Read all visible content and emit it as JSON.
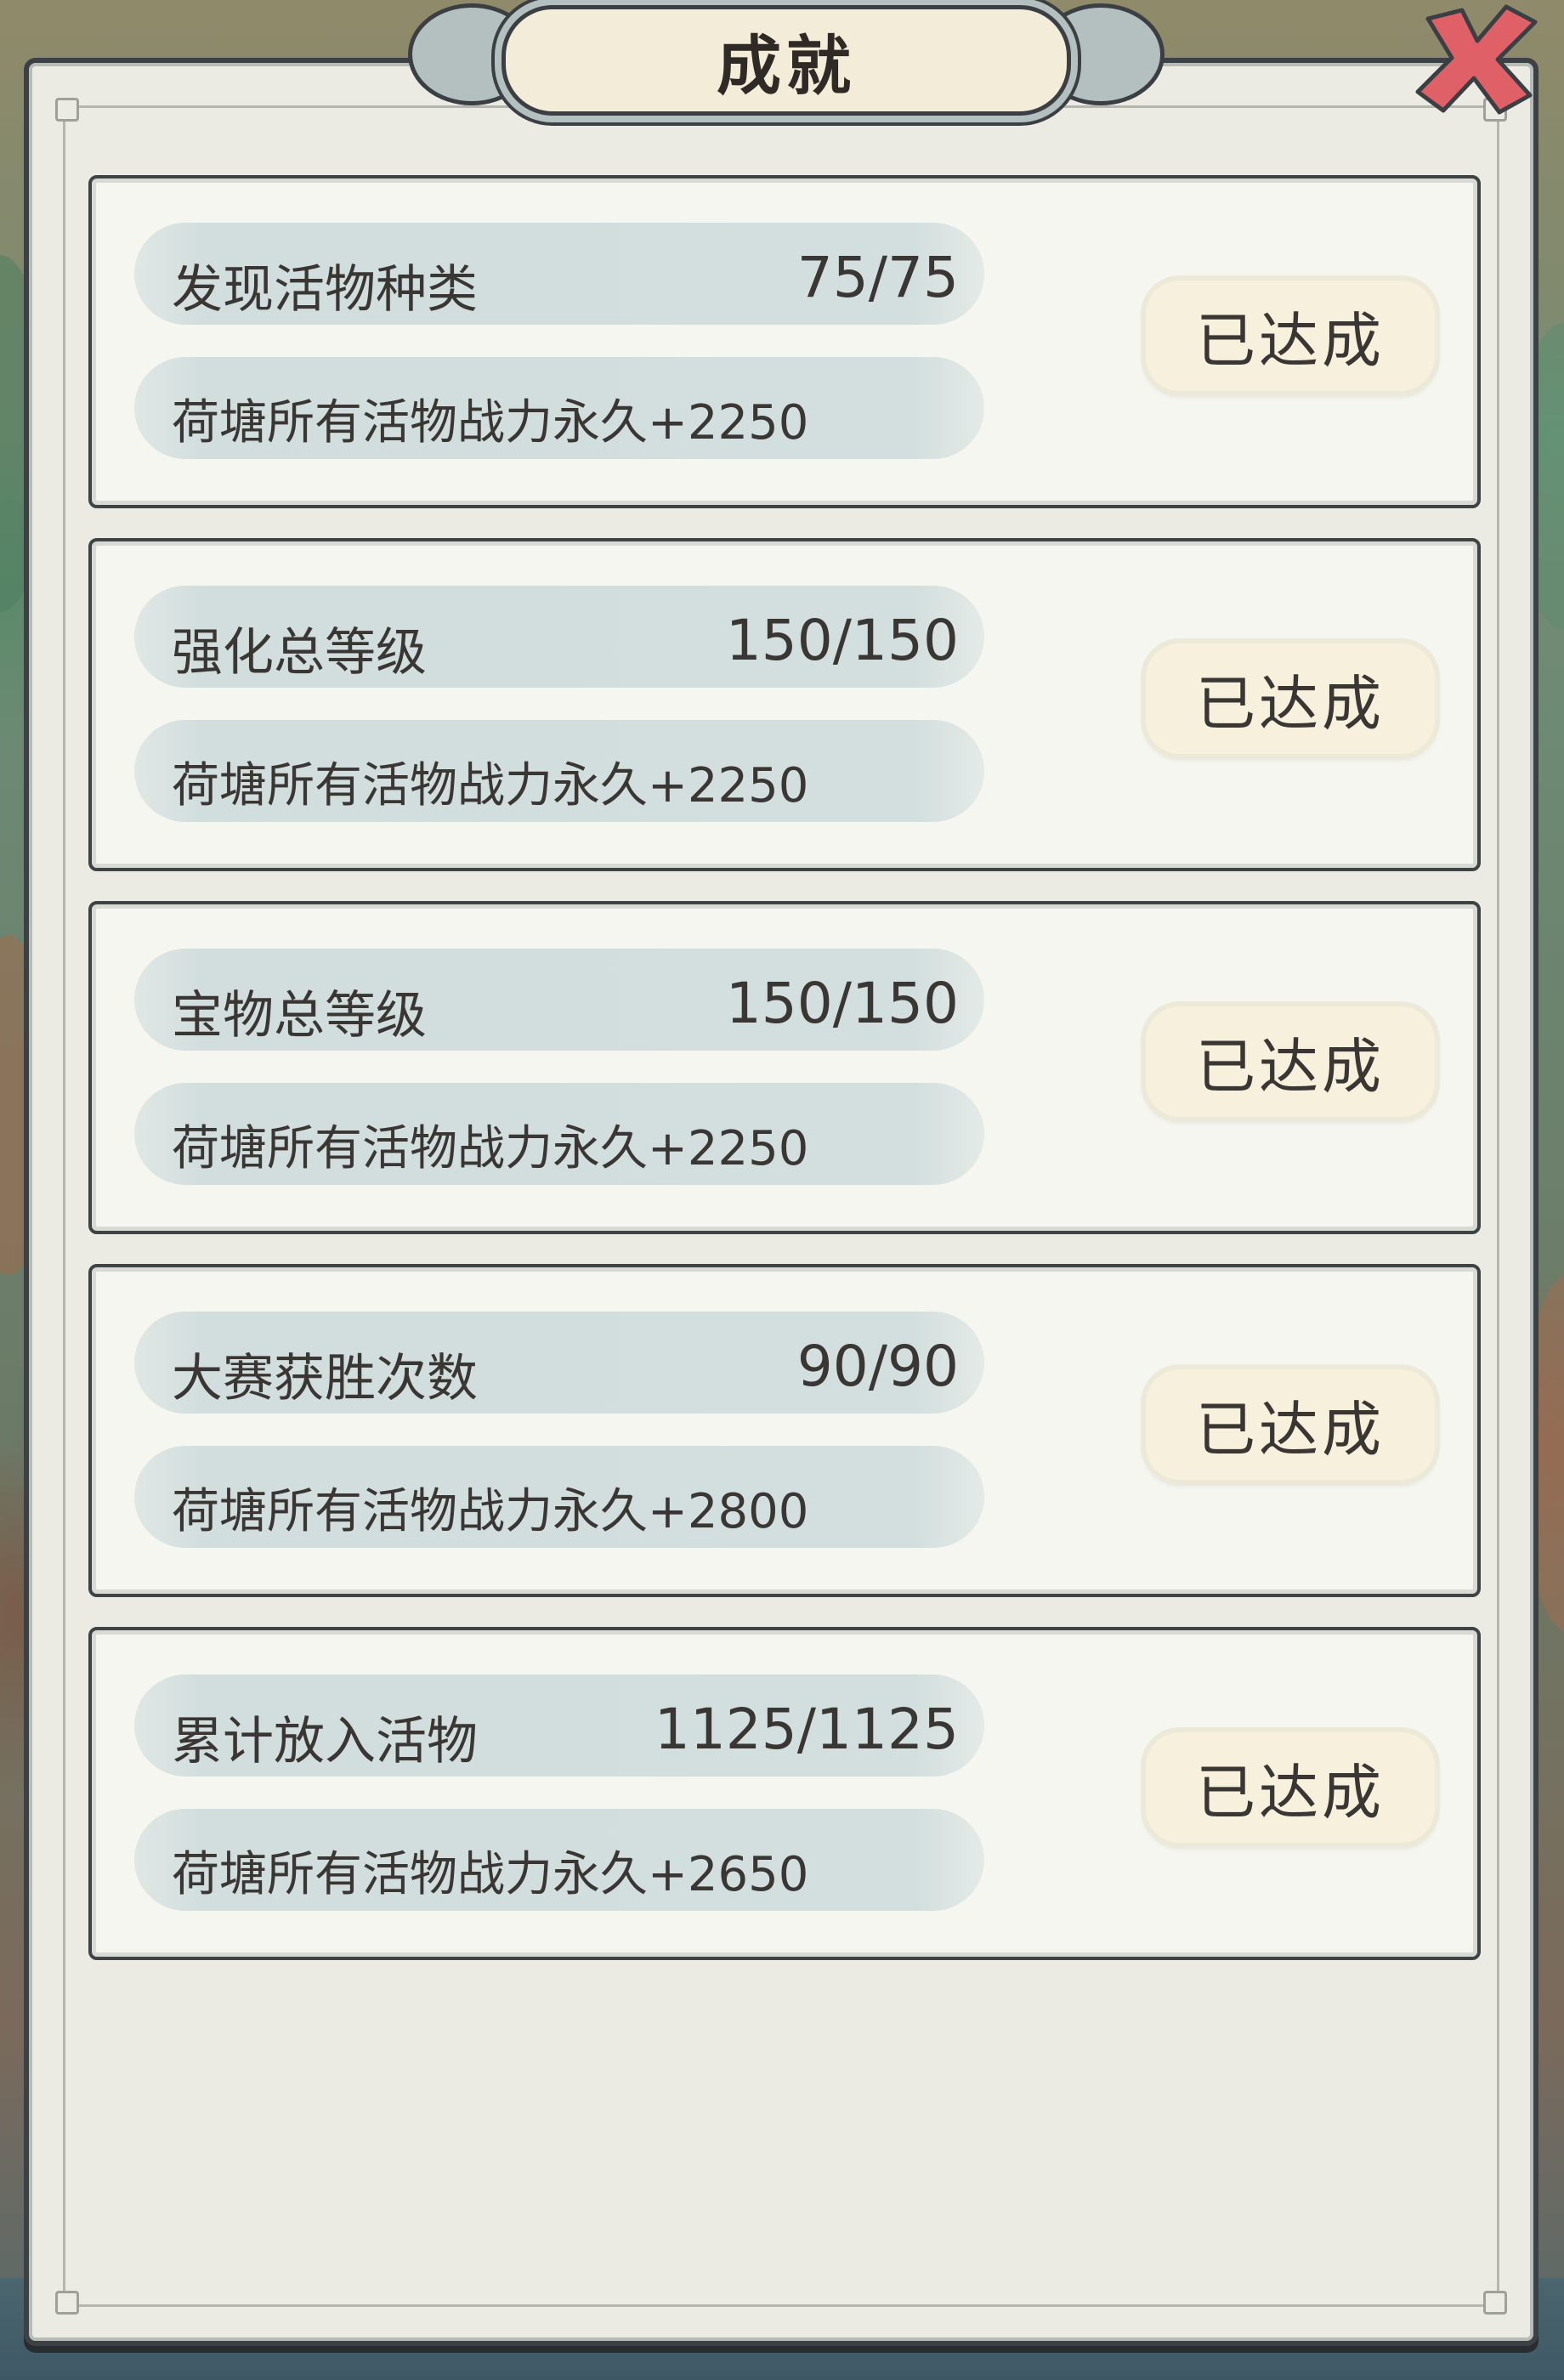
{
  "window": {
    "title": "成就"
  },
  "close_button": {
    "icon": "close-x-icon",
    "color": "#d9545a"
  },
  "achievements": [
    {
      "condition": "发现活物种类",
      "progress": "75/75",
      "reward": "荷塘所有活物战力永久+2250",
      "status": "已达成"
    },
    {
      "condition": "强化总等级",
      "progress": "150/150",
      "reward": "荷塘所有活物战力永久+2250",
      "status": "已达成"
    },
    {
      "condition": "宝物总等级",
      "progress": "150/150",
      "reward": "荷塘所有活物战力永久+2250",
      "status": "已达成"
    },
    {
      "condition": "大赛获胜次数",
      "progress": "90/90",
      "reward": "荷塘所有活物战力永久+2800",
      "status": "已达成"
    },
    {
      "condition": "累计放入活物",
      "progress": "1125/1125",
      "reward": "荷塘所有活物战力永久+2650",
      "status": "已达成"
    }
  ]
}
